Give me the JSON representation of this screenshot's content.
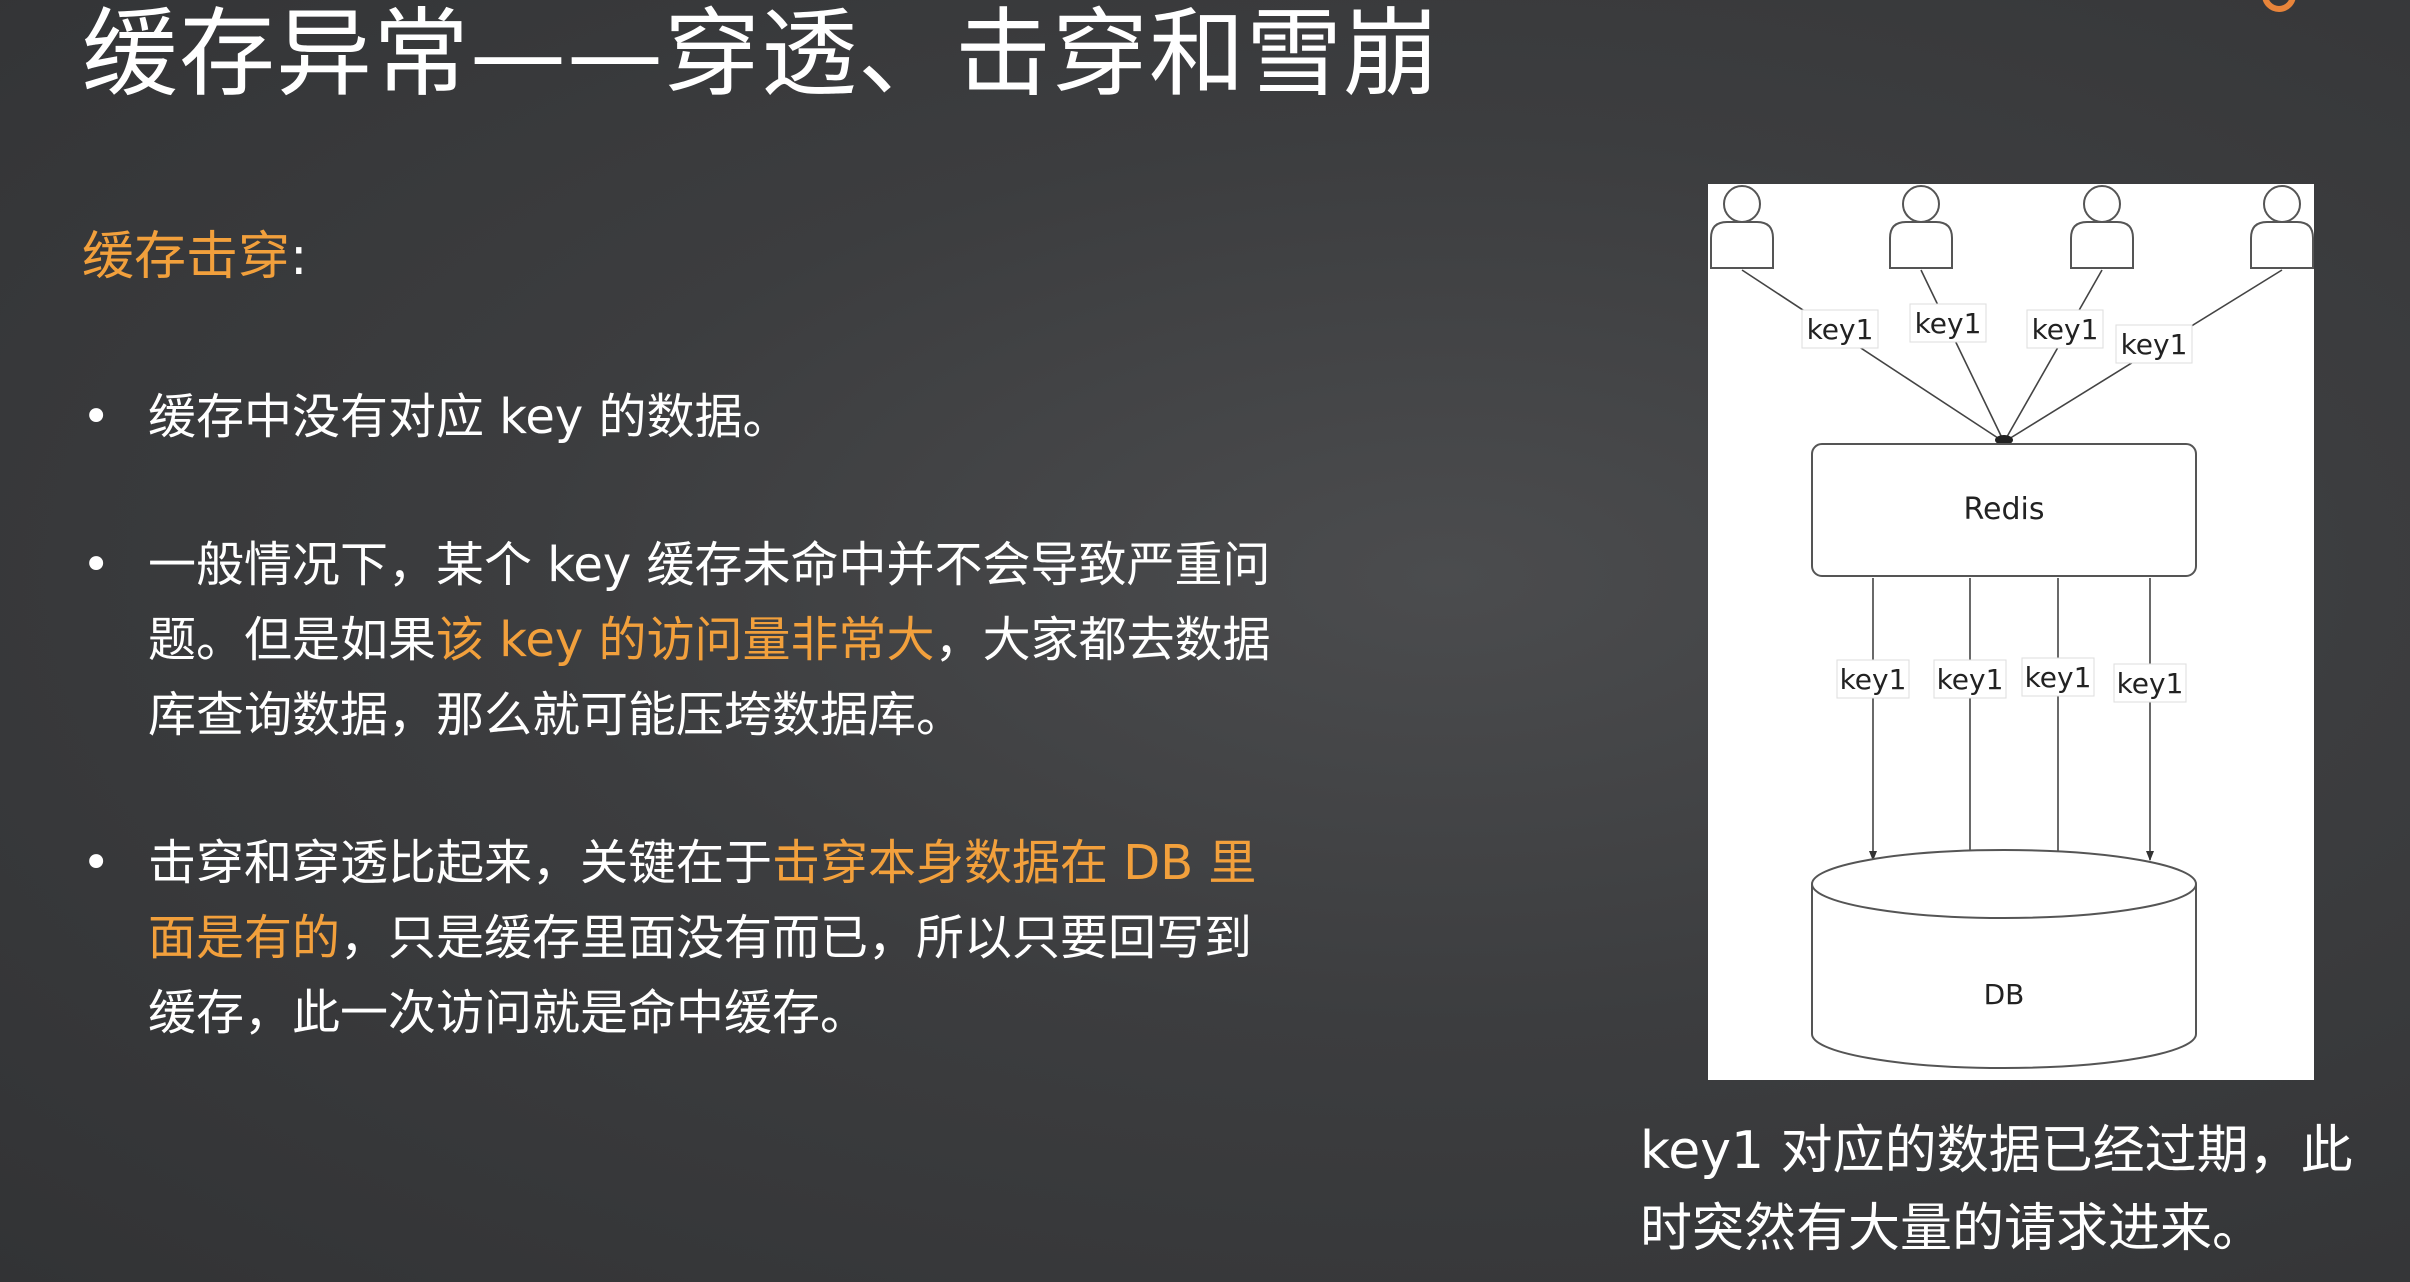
{
  "title": "缓存异常——穿透、击穿和雪崩",
  "section": {
    "heading": "缓存击穿",
    "colon": ":"
  },
  "bullets": [
    {
      "marker": "•",
      "lines": [
        [
          {
            "text": "缓存中没有对应 key 的数据。",
            "highlight": false
          }
        ]
      ]
    },
    {
      "marker": "•",
      "lines": [
        [
          {
            "text": "一般情况下，某个 key 缓存未命中并不会导致严重问",
            "highlight": false
          }
        ],
        [
          {
            "text": "题。但是如果",
            "highlight": false
          },
          {
            "text": "该 key 的访问量非常大",
            "highlight": true
          },
          {
            "text": "，大家都去数据",
            "highlight": false
          }
        ],
        [
          {
            "text": "库查询数据，那么就可能压垮数据库。",
            "highlight": false
          }
        ]
      ]
    },
    {
      "marker": "•",
      "lines": [
        [
          {
            "text": "击穿和穿透比起来，关键在于",
            "highlight": false
          },
          {
            "text": "击穿本身数据在 DB 里",
            "highlight": true
          }
        ],
        [
          {
            "text": "面是有的",
            "highlight": true
          },
          {
            "text": "，只是缓存里面没有而已，所以只要回写到",
            "highlight": false
          }
        ],
        [
          {
            "text": "缓存，此一次访问就是命中缓存。",
            "highlight": false
          }
        ]
      ]
    }
  ],
  "diagram": {
    "request_labels": [
      "key1",
      "key1",
      "key1",
      "key1"
    ],
    "query_labels": [
      "key1",
      "key1",
      "key1",
      "key1"
    ],
    "cache_label": "Redis",
    "db_label": "DB",
    "user_icon": "user-icon"
  },
  "caption": {
    "line1": "key1 对应的数据已经过期，此",
    "line2": "时突然有大量的请求进来。"
  },
  "colors": {
    "highlight": "#f2a03c",
    "text": "#ffffff",
    "background": "#3c3d3f",
    "logo": "#e8843a"
  }
}
